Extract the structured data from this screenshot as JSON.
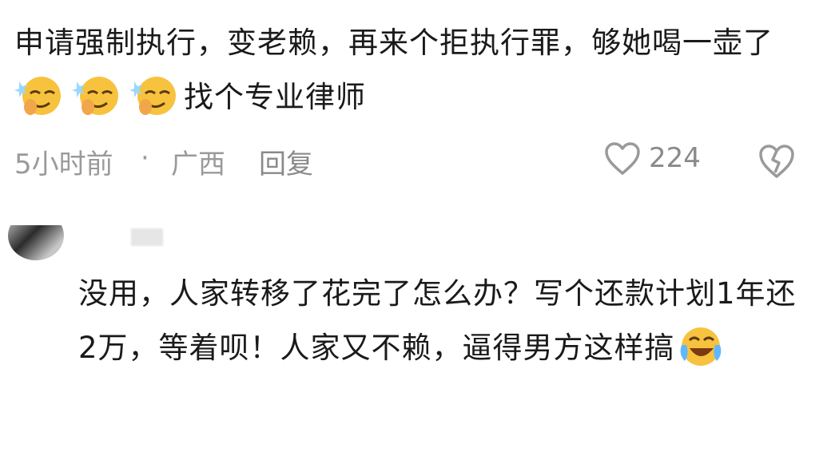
{
  "comment": {
    "text_part1": "申请强制执行，变老赖，再来个拒执行罪，够她喝一壶了",
    "emojis": [
      "smirk-emoji",
      "smirk-emoji",
      "smirk-emoji"
    ],
    "text_part2": "找个专业律师",
    "time": "5小时前",
    "separator": "·",
    "region": "广西",
    "reply_label": "回复",
    "like_count": "224"
  },
  "reply": {
    "text": "没用，人家转移了花完了怎么办？写个还款计划1年还2万，等着呗！人家又不赖，逼得男方这样搞",
    "emoji": "laugh-cry-emoji"
  },
  "colors": {
    "text": "#1a1a1a",
    "meta": "#9a9a9a",
    "emoji_face": "#f7c23d"
  }
}
